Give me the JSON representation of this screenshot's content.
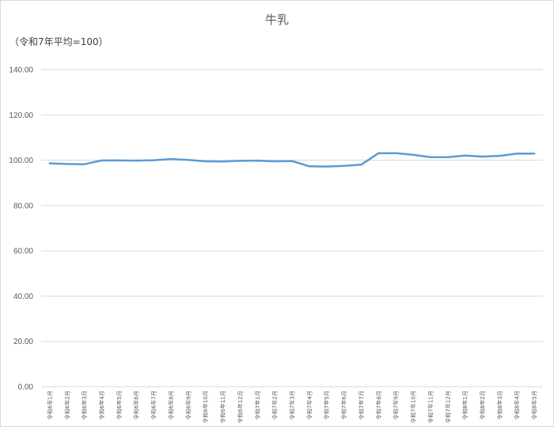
{
  "chart_data": {
    "type": "line",
    "title": "牛乳",
    "unit_label": "（令和7年平均=100）",
    "xlabel": "",
    "ylabel": "",
    "ylim": [
      0,
      140
    ],
    "yticks": [
      "0.00",
      "20.00",
      "40.00",
      "60.00",
      "80.00",
      "100.00",
      "120.00",
      "140.00"
    ],
    "ytick_values": [
      0,
      20,
      40,
      60,
      80,
      100,
      120,
      140
    ],
    "grid": true,
    "line_color": "#5b9bd5",
    "categories": [
      "令和6年1月",
      "令和6年2月",
      "令和6年3月",
      "令和6年4月",
      "令和6年5月",
      "令和6年6月",
      "令和6年7月",
      "令和6年8月",
      "令和6年9月",
      "令和6年10月",
      "令和6年11月",
      "令和6年12月",
      "令和7年1月",
      "令和7年2月",
      "令和7年3月",
      "令和7年4月",
      "令和7年5月",
      "令和7年6月",
      "令和7年7月",
      "令和7年8月",
      "令和7年9月",
      "令和7年10月",
      "令和7年11月",
      "令和7年12月",
      "令和8年1月",
      "令和8年2月",
      "令和8年3月",
      "令和8年4月",
      "令和8年5月"
    ],
    "series": [
      {
        "values": [
          98.6,
          98.3,
          98.2,
          99.9,
          99.9,
          99.8,
          100.0,
          100.5,
          100.1,
          99.5,
          99.4,
          99.7,
          99.8,
          99.5,
          99.6,
          97.3,
          97.2,
          97.5,
          98.0,
          103.1,
          103.1,
          102.4,
          101.3,
          101.3,
          102.0,
          101.6,
          101.9,
          102.9,
          102.9
        ]
      }
    ]
  }
}
